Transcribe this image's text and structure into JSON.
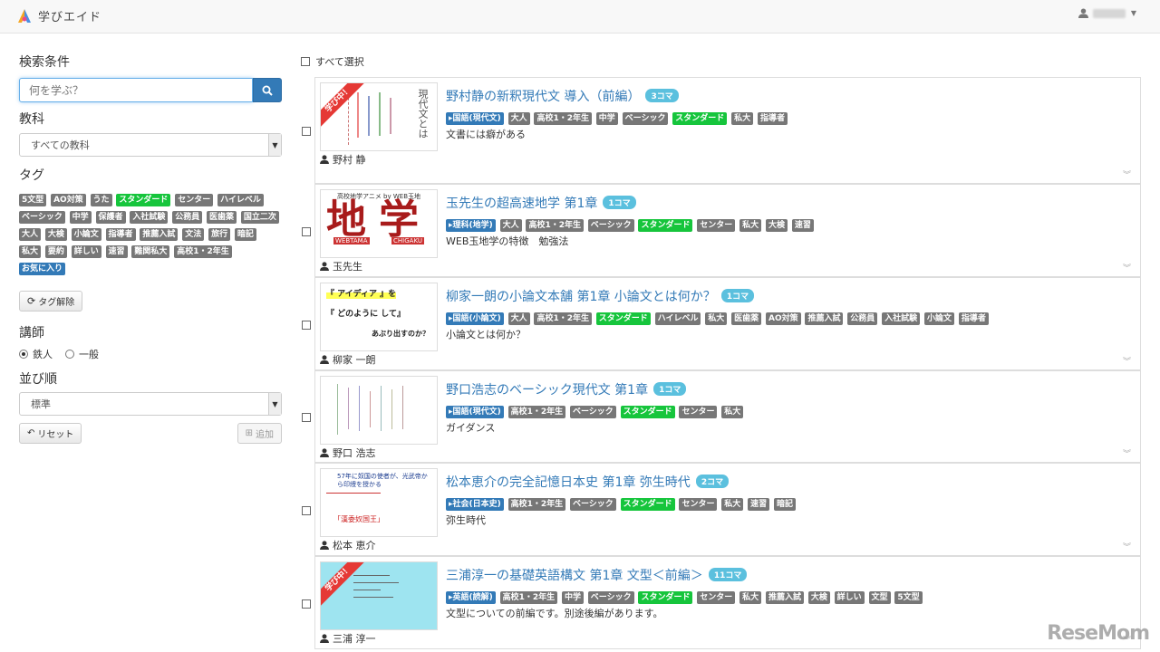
{
  "header": {
    "logo_text": "学びエイド",
    "user_name": ""
  },
  "sidebar": {
    "search_title": "検索条件",
    "search_placeholder": "何を学ぶ？",
    "subject_title": "教科",
    "subject_value": "すべての教科",
    "tag_title": "タグ",
    "tags": [
      {
        "label": "5文型",
        "color": "gray"
      },
      {
        "label": "AO対策",
        "color": "gray"
      },
      {
        "label": "うた",
        "color": "gray"
      },
      {
        "label": "スタンダード",
        "color": "green"
      },
      {
        "label": "センター",
        "color": "gray"
      },
      {
        "label": "ハイレベル",
        "color": "gray"
      },
      {
        "label": "ベーシック",
        "color": "gray"
      },
      {
        "label": "中学",
        "color": "gray"
      },
      {
        "label": "保護者",
        "color": "gray"
      },
      {
        "label": "入社試験",
        "color": "gray"
      },
      {
        "label": "公務員",
        "color": "gray"
      },
      {
        "label": "医歯薬",
        "color": "gray"
      },
      {
        "label": "国立二次",
        "color": "gray"
      },
      {
        "label": "大人",
        "color": "gray"
      },
      {
        "label": "大検",
        "color": "gray"
      },
      {
        "label": "小論文",
        "color": "gray"
      },
      {
        "label": "指導者",
        "color": "gray"
      },
      {
        "label": "推薦入試",
        "color": "gray"
      },
      {
        "label": "文法",
        "color": "gray"
      },
      {
        "label": "旅行",
        "color": "gray"
      },
      {
        "label": "暗記",
        "color": "gray"
      },
      {
        "label": "私大",
        "color": "gray"
      },
      {
        "label": "要約",
        "color": "gray"
      },
      {
        "label": "詳しい",
        "color": "gray"
      },
      {
        "label": "速習",
        "color": "gray"
      },
      {
        "label": "難関私大",
        "color": "gray"
      },
      {
        "label": "高校1・2年生",
        "color": "gray"
      },
      {
        "label": "お気に入り",
        "color": "blue"
      }
    ],
    "tag_reset": "タグ解除",
    "teacher_title": "講師",
    "teacher_options": [
      "鉄人",
      "一般"
    ],
    "sort_title": "並び順",
    "sort_value": "標準",
    "reset_label": "リセット",
    "add_label": "追加"
  },
  "main": {
    "select_all": "すべて選択",
    "ribbon_text": "学び中！",
    "courses": [
      {
        "title": "野村静の新釈現代文 導入（前編）",
        "koma": "3コマ",
        "subject": "国語(現代文)",
        "tags": [
          "大人",
          "高校1・2年生",
          "中学",
          "ベーシック",
          "スタンダード",
          "私大",
          "指導者"
        ],
        "desc": "文書には癖がある",
        "teacher": "野村 静",
        "learning": true
      },
      {
        "title": "玉先生の超高速地学 第1章",
        "koma": "1コマ",
        "subject": "理科(地学)",
        "tags": [
          "大人",
          "高校1・2年生",
          "ベーシック",
          "スタンダード",
          "センター",
          "私大",
          "大検",
          "速習"
        ],
        "desc": "WEB玉地学の特徴　勉強法",
        "teacher": "玉先生",
        "learning": false
      },
      {
        "title": "柳家一朗の小論文本舗 第1章 小論文とは何か？",
        "koma": "1コマ",
        "subject": "国語(小論文)",
        "tags": [
          "大人",
          "高校1・2年生",
          "スタンダード",
          "ハイレベル",
          "私大",
          "医歯薬",
          "AO対策",
          "推薦入試",
          "公務員",
          "入社試験",
          "小論文",
          "指導者"
        ],
        "desc": "小論文とは何か？",
        "teacher": "柳家 一朗",
        "learning": false
      },
      {
        "title": "野口浩志のベーシック現代文 第1章",
        "koma": "1コマ",
        "subject": "国語(現代文)",
        "tags": [
          "高校1・2年生",
          "ベーシック",
          "スタンダード",
          "センター",
          "私大"
        ],
        "desc": "ガイダンス",
        "teacher": "野口 浩志",
        "learning": false
      },
      {
        "title": "松本恵介の完全記憶日本史 第1章 弥生時代",
        "koma": "2コマ",
        "subject": "社会(日本史)",
        "tags": [
          "高校1・2年生",
          "ベーシック",
          "スタンダード",
          "センター",
          "私大",
          "速習",
          "暗記"
        ],
        "desc": "弥生時代",
        "teacher": "松本 恵介",
        "learning": false
      },
      {
        "title": "三浦淳一の基礎英語構文 第1章 文型＜前編＞",
        "koma": "11コマ",
        "subject": "英語(読解)",
        "tags": [
          "高校1・2年生",
          "中学",
          "ベーシック",
          "スタンダード",
          "センター",
          "私大",
          "推薦入試",
          "大検",
          "詳しい",
          "文型",
          "5文型"
        ],
        "desc": "文型についての前編です。別途後編があります。",
        "teacher": "三浦 淳一",
        "learning": true
      }
    ]
  },
  "thumbs": {
    "t1": "現代文とは",
    "t2_top": "高校地学アニメ by WEB玉地",
    "t2_big": "地学",
    "t2_l": "WEBTAMA",
    "t2_r": "CHIGAKU",
    "t3_a": "『 アイディア 』を",
    "t3_b": "『 どのように して』",
    "t3_c": "あぶり出すのか？",
    "t5_a": "57年に奴国の使者が、光武帝から印綬を授かる",
    "t5_b": "「漢委奴国王」"
  },
  "watermark": "ReseMom",
  "colors": {
    "accent": "#337ab7",
    "green_tag": "#16c53c",
    "gray_tag": "#777777",
    "ribbon": "#e53935",
    "koma": "#5bc0de"
  }
}
